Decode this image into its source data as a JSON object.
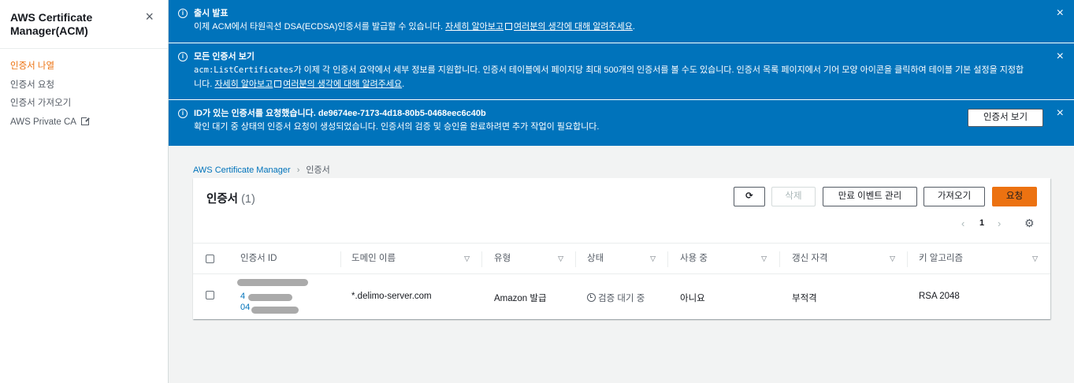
{
  "sidebar": {
    "title": "AWS Certificate Manager(ACM)",
    "close_icon": "×",
    "items": [
      {
        "label": "인증서 나열",
        "active": true
      },
      {
        "label": "인증서 요청"
      },
      {
        "label": "인증서 가져오기"
      },
      {
        "label": "AWS Private CA"
      }
    ]
  },
  "flash": {
    "release": {
      "title": "출시 발표",
      "text": "이제 ACM에서 타원곡선 DSA(ECDSA)인증서를 발급할 수 있습니다.",
      "learn_more": "자세히 알아보고",
      "feedback": "여러분의 생각에 대해 알려주세요",
      "period": "."
    },
    "all_certs": {
      "title": "모든 인증서 보기",
      "code": "acm:ListCertificates",
      "text": "가 이제 각 인증서 요약에서 세부 정보를 지원합니다. 인증서 테이블에서 페이지당 최대 500개의 인증서를 볼 수도 있습니다. 인증서 목록 페이지에서 기어 모양 아이콘을 클릭하여 테이블 기본 설정을 지정합니다.",
      "learn_more": "자세히 알아보고",
      "feedback": "여러분의 생각에 대해 알려주세요",
      "period": "."
    },
    "requested": {
      "title": "ID가 있는 인증서를 요청했습니다. de9674ee-7173-4d18-80b5-0468eec6c40b",
      "text": "확인 대기 중 상태의 인증서 요청이 생성되었습니다. 인증서의 검증 및 승인을 완료하려면 추가 작업이 필요합니다.",
      "button": "인증서 보기"
    },
    "close_icon": "×",
    "info_icon": "i"
  },
  "breadcrumb": {
    "root": "AWS Certificate Manager",
    "current": "인증서"
  },
  "table": {
    "title": "인증서",
    "count": "(1)",
    "buttons": {
      "refresh": "⟳",
      "delete": "삭제",
      "manage_events": "만료 이벤트 관리",
      "import": "가져오기",
      "request": "요청"
    },
    "pagination": {
      "prev": "‹",
      "page": "1",
      "next": "›"
    },
    "settings_icon": "⚙",
    "sort_icon": "▽",
    "columns": [
      "인증서 ID",
      "도메인 이름",
      "유형",
      "상태",
      "사용 중",
      "갱신 자격",
      "키 알고리즘"
    ],
    "rows": [
      {
        "id_line1": "4",
        "id_line2": "04",
        "domain": "*.delimo-server.com",
        "type": "Amazon 발급",
        "status": "검증 대기 중",
        "in_use": "아니요",
        "renewal": "부적격",
        "key_algorithm": "RSA 2048"
      }
    ]
  }
}
